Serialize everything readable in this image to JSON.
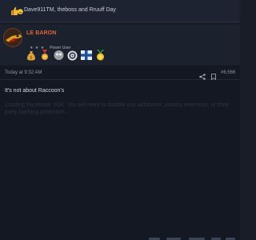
{
  "reactions": {
    "summary": "Dave911TM, theboss and Rruuff Day",
    "icons": [
      "thumbs-up-icon",
      "laugh-icon"
    ]
  },
  "post": {
    "author": {
      "username": "LE BARON",
      "rank_stars": "★ ★ ★",
      "title": "Power User",
      "avatar": "avatar-image",
      "trophies": [
        "money-bag-icon",
        "medal-icon",
        "bird-face-icon",
        "target-icon",
        "cross-flag-icon",
        "gift-medal-icon"
      ]
    },
    "date": "Today at 9:32 AM",
    "number": "#6,566",
    "message": "It's not about Raccoon's",
    "faded_notice": "Loading Facebook SDK. You will need to disable any adblocker, privacy extension, or third-party tracking protection."
  },
  "colors": {
    "background": "#181d27",
    "username": "#e1633a",
    "text": "#d3d7df"
  }
}
